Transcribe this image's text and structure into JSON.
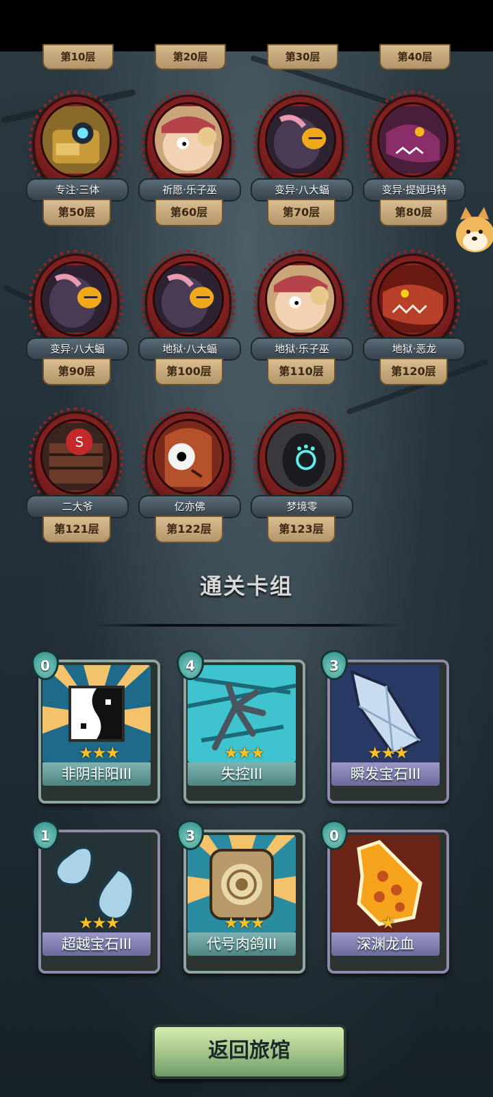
{
  "top_floors": [
    "第10层",
    "第20层",
    "第30层",
    "第40层"
  ],
  "bosses": [
    {
      "name": "专注·三体",
      "floor": "第50层"
    },
    {
      "name": "祈愿·乐子巫",
      "floor": "第60层"
    },
    {
      "name": "变异·八大蝠",
      "floor": "第70层"
    },
    {
      "name": "变异·提娅玛特",
      "floor": "第80层"
    },
    {
      "name": "变异·八大蝠",
      "floor": "第90层"
    },
    {
      "name": "地狱·八大蝠",
      "floor": "第100层"
    },
    {
      "name": "地狱·乐子巫",
      "floor": "第110层"
    },
    {
      "name": "地狱·恶龙",
      "floor": "第120层"
    },
    {
      "name": "二大爷",
      "floor": "第121层"
    },
    {
      "name": "亿亦佛",
      "floor": "第122层"
    },
    {
      "name": "梦境零",
      "floor": "第123层"
    }
  ],
  "section_title": "通关卡组",
  "cards": [
    {
      "name": "非阴非阳III",
      "cost": "0",
      "stars": "★★★"
    },
    {
      "name": "失控III",
      "cost": "4",
      "stars": "★★★"
    },
    {
      "name": "瞬发宝石III",
      "cost": "3",
      "stars": "★★★"
    },
    {
      "name": "超越宝石III",
      "cost": "1",
      "stars": "★★★"
    },
    {
      "name": "代号肉鸽III",
      "cost": "3",
      "stars": "★★★"
    },
    {
      "name": "深渊龙血",
      "cost": "0",
      "stars": "★"
    }
  ],
  "return_button": "返回旅馆",
  "icons": {
    "companion": "shiba-dog-icon"
  }
}
